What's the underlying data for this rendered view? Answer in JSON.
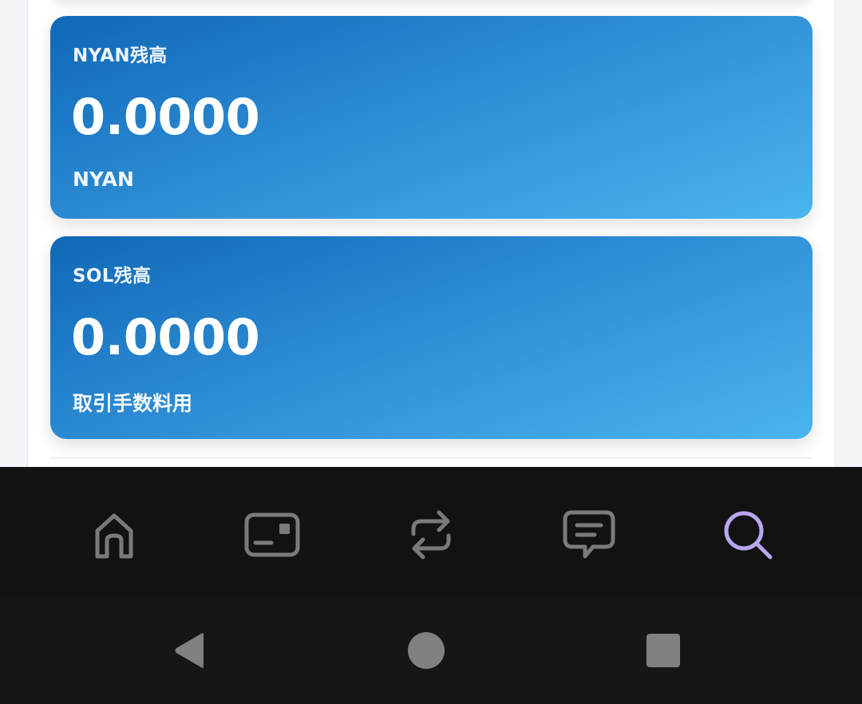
{
  "cards": [
    {
      "label": "NYAN残高",
      "value": "0.0000",
      "sub": "NYAN"
    },
    {
      "label": "SOL残高",
      "value": "0.0000",
      "sub": "取引手数料用"
    }
  ],
  "bottom_nav": {
    "items": [
      {
        "icon": "home-icon",
        "active": false
      },
      {
        "icon": "wallet-card-icon",
        "active": false
      },
      {
        "icon": "swap-arrows-icon",
        "active": false
      },
      {
        "icon": "message-icon",
        "active": false
      },
      {
        "icon": "search-icon",
        "active": true
      }
    ],
    "active_color": "#b9a6f0",
    "inactive_color": "#7a7a7a"
  },
  "system_nav": {
    "buttons": [
      "back-icon",
      "home-circle-icon",
      "recents-icon"
    ],
    "color": "#808184"
  },
  "colors": {
    "card_gradient_start": "#1068b6",
    "card_gradient_end": "#4ab5ee"
  }
}
